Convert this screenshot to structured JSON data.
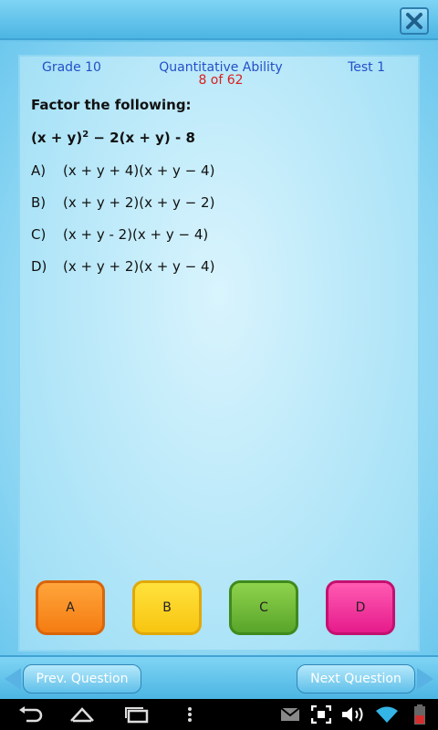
{
  "header": {
    "grade": "Grade 10",
    "subject": "Quantitative Ability",
    "test": "Test 1",
    "counter": "8 of 62"
  },
  "question": {
    "title": "Factor the following:",
    "expression_base": "(x + y)",
    "expression_power": "2",
    "expression_rest": " − 2(x + y) - 8"
  },
  "options": [
    {
      "letter": "A)",
      "text": "(x + y + 4)(x + y − 4)"
    },
    {
      "letter": "B)",
      "text": "(x + y + 2)(x + y − 2)"
    },
    {
      "letter": "C)",
      "text": "(x + y - 2)(x + y − 4)"
    },
    {
      "letter": "D)",
      "text": "(x + y + 2)(x + y − 4)"
    }
  ],
  "answers": {
    "a": "A",
    "b": "B",
    "c": "C",
    "d": "D"
  },
  "navigation": {
    "prev_label": "Prev. Question",
    "next_label": "Next Question"
  },
  "colors": {
    "accent_blue": "#4cb5e3",
    "header_text": "#2450c8",
    "counter_text": "#d81f1f",
    "answer_a": "#f47c12",
    "answer_b": "#f8c511",
    "answer_c": "#58a52a",
    "answer_d": "#e61b8c"
  },
  "icons": {
    "close": "close-icon",
    "back": "back-icon",
    "home": "home-icon",
    "recents": "recents-icon",
    "menu": "overflow-menu-icon",
    "gmail": "gmail-icon",
    "screenshot": "screenshot-icon",
    "volume": "volume-icon",
    "wifi": "wifi-icon",
    "battery": "battery-icon"
  }
}
